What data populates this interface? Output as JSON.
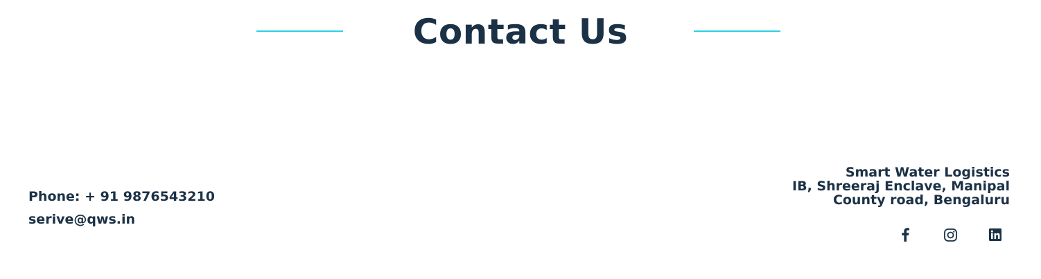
{
  "heading": {
    "title": "Contact Us",
    "accent_color": "#2ad1e4",
    "text_color": "#1b3146"
  },
  "contact": {
    "phone": "Phone: + 91 9876543210",
    "email": "serive@qws.in"
  },
  "address": {
    "company": "Smart Water Logistics",
    "line1": "IB, Shreeraj Enclave, Manipal",
    "line2": "County road, Bengaluru"
  },
  "social": [
    {
      "icon": "facebook-icon"
    },
    {
      "icon": "instagram-icon"
    },
    {
      "icon": "linkedin-icon"
    }
  ]
}
